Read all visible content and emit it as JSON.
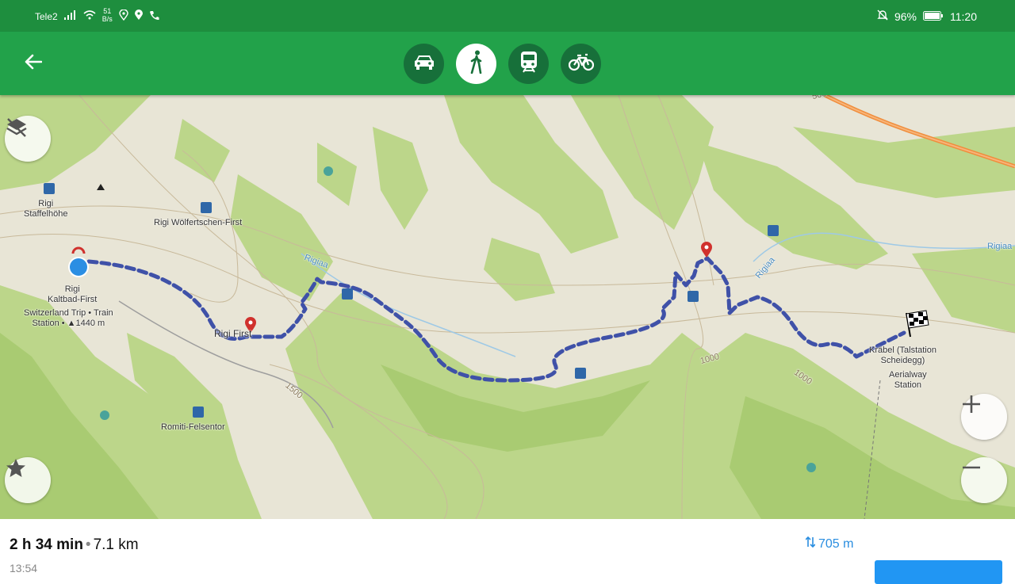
{
  "status_bar": {
    "carrier": "Tele2",
    "speed_value": "51",
    "speed_unit": "B/s",
    "battery": "96%",
    "time": "11:20"
  },
  "toolbar": {
    "modes": [
      {
        "name": "car",
        "icon": "car-icon",
        "active": false
      },
      {
        "name": "walk",
        "icon": "walk-icon",
        "active": true
      },
      {
        "name": "transit",
        "icon": "train-icon",
        "active": false
      },
      {
        "name": "bike",
        "icon": "bike-icon",
        "active": false
      }
    ]
  },
  "map": {
    "labels": {
      "staffelhoehe": "Rigi\nStaffelhöhe",
      "woelfertschen": "Rigi Wölfertschen-First",
      "kaltbad_first": "Rigi\nKaltbad-First",
      "kaltbad_desc": "Switzerland Trip • Train\nStation • ▲1440 m",
      "rigi_first": "Rigi First",
      "romiti": "Romiti-Felsentor",
      "krabel": "Kräbel (Talstation\nScheidegg)",
      "krabel_desc": "Aerialway\nStation",
      "river1": "Rigiaa",
      "river2": "Rigiaa",
      "river3": "Rigiaa",
      "contour_1500": "1500",
      "contour_1000a": "1000",
      "contour_1000b": "1000",
      "contour_500": "500"
    }
  },
  "route": {
    "duration": "2 h 34 min",
    "separator": "•",
    "distance": "7.1 km",
    "ascent": "705 m",
    "arrival_time": "13:54"
  },
  "colors": {
    "toolbar": "#22a24a",
    "statusbar": "#1e8e3e",
    "route_line": "#3f51a8",
    "accent_blue": "#2196f3"
  }
}
